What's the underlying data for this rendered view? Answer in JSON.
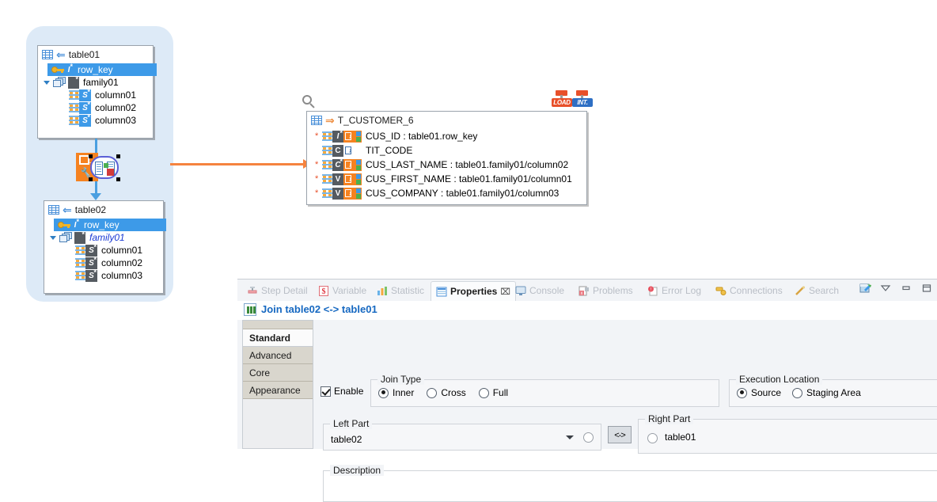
{
  "canvas": {
    "table01": {
      "name": "table01",
      "direction_icon": "arrow-left-blue",
      "rows": [
        {
          "label": "row_key",
          "type_badge": "I",
          "starred": true,
          "selected": true,
          "icon": "key-icon"
        },
        {
          "label": "family01",
          "type_badge": "",
          "starred": true,
          "selected": false,
          "icon": "family-icon",
          "italic": false
        },
        {
          "label": "column01",
          "type_badge": "S",
          "starred": true,
          "selected": false,
          "icon": "column-icon",
          "badge_color": "blue"
        },
        {
          "label": "column02",
          "type_badge": "S",
          "starred": true,
          "selected": false,
          "icon": "column-icon",
          "badge_color": "blue"
        },
        {
          "label": "column03",
          "type_badge": "S",
          "starred": true,
          "selected": false,
          "icon": "column-icon",
          "badge_color": "blue"
        }
      ]
    },
    "table02": {
      "name": "table02",
      "direction_icon": "arrow-left-blue",
      "rows": [
        {
          "label": "row_key",
          "type_badge": "I",
          "starred": true,
          "selected": true,
          "icon": "key-icon"
        },
        {
          "label": "family01",
          "type_badge": "",
          "starred": true,
          "selected": false,
          "icon": "family-icon",
          "italic": true
        },
        {
          "label": "column01",
          "type_badge": "S",
          "starred": true,
          "selected": false,
          "icon": "column-icon",
          "badge_color": "grey"
        },
        {
          "label": "column02",
          "type_badge": "S",
          "starred": true,
          "selected": false,
          "icon": "column-icon",
          "badge_color": "grey"
        },
        {
          "label": "column03",
          "type_badge": "S",
          "starred": true,
          "selected": false,
          "icon": "column-icon",
          "badge_color": "grey"
        }
      ]
    },
    "join_component": {
      "name": "join-component",
      "selected": true
    },
    "target": {
      "name": "T_CUSTOMER_6",
      "direction_icon": "arrow-right-orange",
      "rows": [
        {
          "label": "CUS_ID : table01.row_key",
          "type_badge": "I",
          "key": true,
          "starred": true,
          "has_ui_badge": true
        },
        {
          "label": "TIT_CODE",
          "type_badge": "C",
          "key": false,
          "starred": false,
          "has_ui_badge": false
        },
        {
          "label": "CUS_LAST_NAME : table01.family01/column02",
          "type_badge": "C",
          "key": false,
          "starred": true,
          "has_ui_badge": true
        },
        {
          "label": "CUS_FIRST_NAME : table01.family01/column01",
          "type_badge": "V",
          "key": false,
          "starred": true,
          "has_ui_badge": true
        },
        {
          "label": "CUS_COMPANY : table01.family01/column03",
          "type_badge": "V",
          "key": false,
          "starred": true,
          "has_ui_badge": true
        }
      ],
      "tags": [
        {
          "text": "LOAD",
          "color": "#e8502a"
        },
        {
          "text": "INT.",
          "color": "#2e6fc4"
        }
      ]
    }
  },
  "panel": {
    "view_tabs": [
      {
        "label": "Step Detail",
        "icon": "step-detail-icon",
        "active": false
      },
      {
        "label": "Variable",
        "icon": "variable-icon",
        "active": false
      },
      {
        "label": "Statistic",
        "icon": "statistic-icon",
        "active": false
      },
      {
        "label": "Properties",
        "icon": "properties-icon",
        "active": true,
        "close": "⌧"
      },
      {
        "label": "Console",
        "icon": "console-icon",
        "active": false
      },
      {
        "label": "Problems",
        "icon": "problems-icon",
        "active": false
      },
      {
        "label": "Error Log",
        "icon": "error-log-icon",
        "active": false
      },
      {
        "label": "Connections",
        "icon": "connections-icon",
        "active": false
      },
      {
        "label": "Search",
        "icon": "search-icon",
        "active": false
      }
    ],
    "window_buttons": [
      "pin-icon",
      "view-menu-icon",
      "minimize-icon",
      "maximize-icon"
    ],
    "title": "Join table02 <-> table01",
    "side_tabs": [
      {
        "label": "Standard",
        "active": true
      },
      {
        "label": "Advanced",
        "active": false
      },
      {
        "label": "Core",
        "active": false
      },
      {
        "label": "Appearance",
        "active": false
      }
    ],
    "form": {
      "enable": {
        "label": "Enable",
        "checked": true
      },
      "join_type": {
        "legend": "Join Type",
        "options": [
          {
            "label": "Inner",
            "selected": true
          },
          {
            "label": "Cross",
            "selected": false
          },
          {
            "label": "Full",
            "selected": false
          }
        ]
      },
      "execution_location": {
        "legend": "Execution Location",
        "options": [
          {
            "label": "Source",
            "selected": true
          },
          {
            "label": "Staging Area",
            "selected": false
          }
        ]
      },
      "left_part": {
        "legend": "Left Part",
        "value": "table02",
        "radio_selected": false
      },
      "right_part": {
        "legend": "Right Part",
        "value": "table01",
        "radio_selected": false
      },
      "swap_button": "<->",
      "description": {
        "legend": "Description",
        "value": ""
      }
    }
  },
  "colors": {
    "accent_blue": "#3d9ae8",
    "link_blue": "#1668c1",
    "orange": "#f58220",
    "group_bg": "#ddeaf7",
    "panel_bg": "#f2f4f7",
    "tab_beige": "#d9d6cd"
  }
}
